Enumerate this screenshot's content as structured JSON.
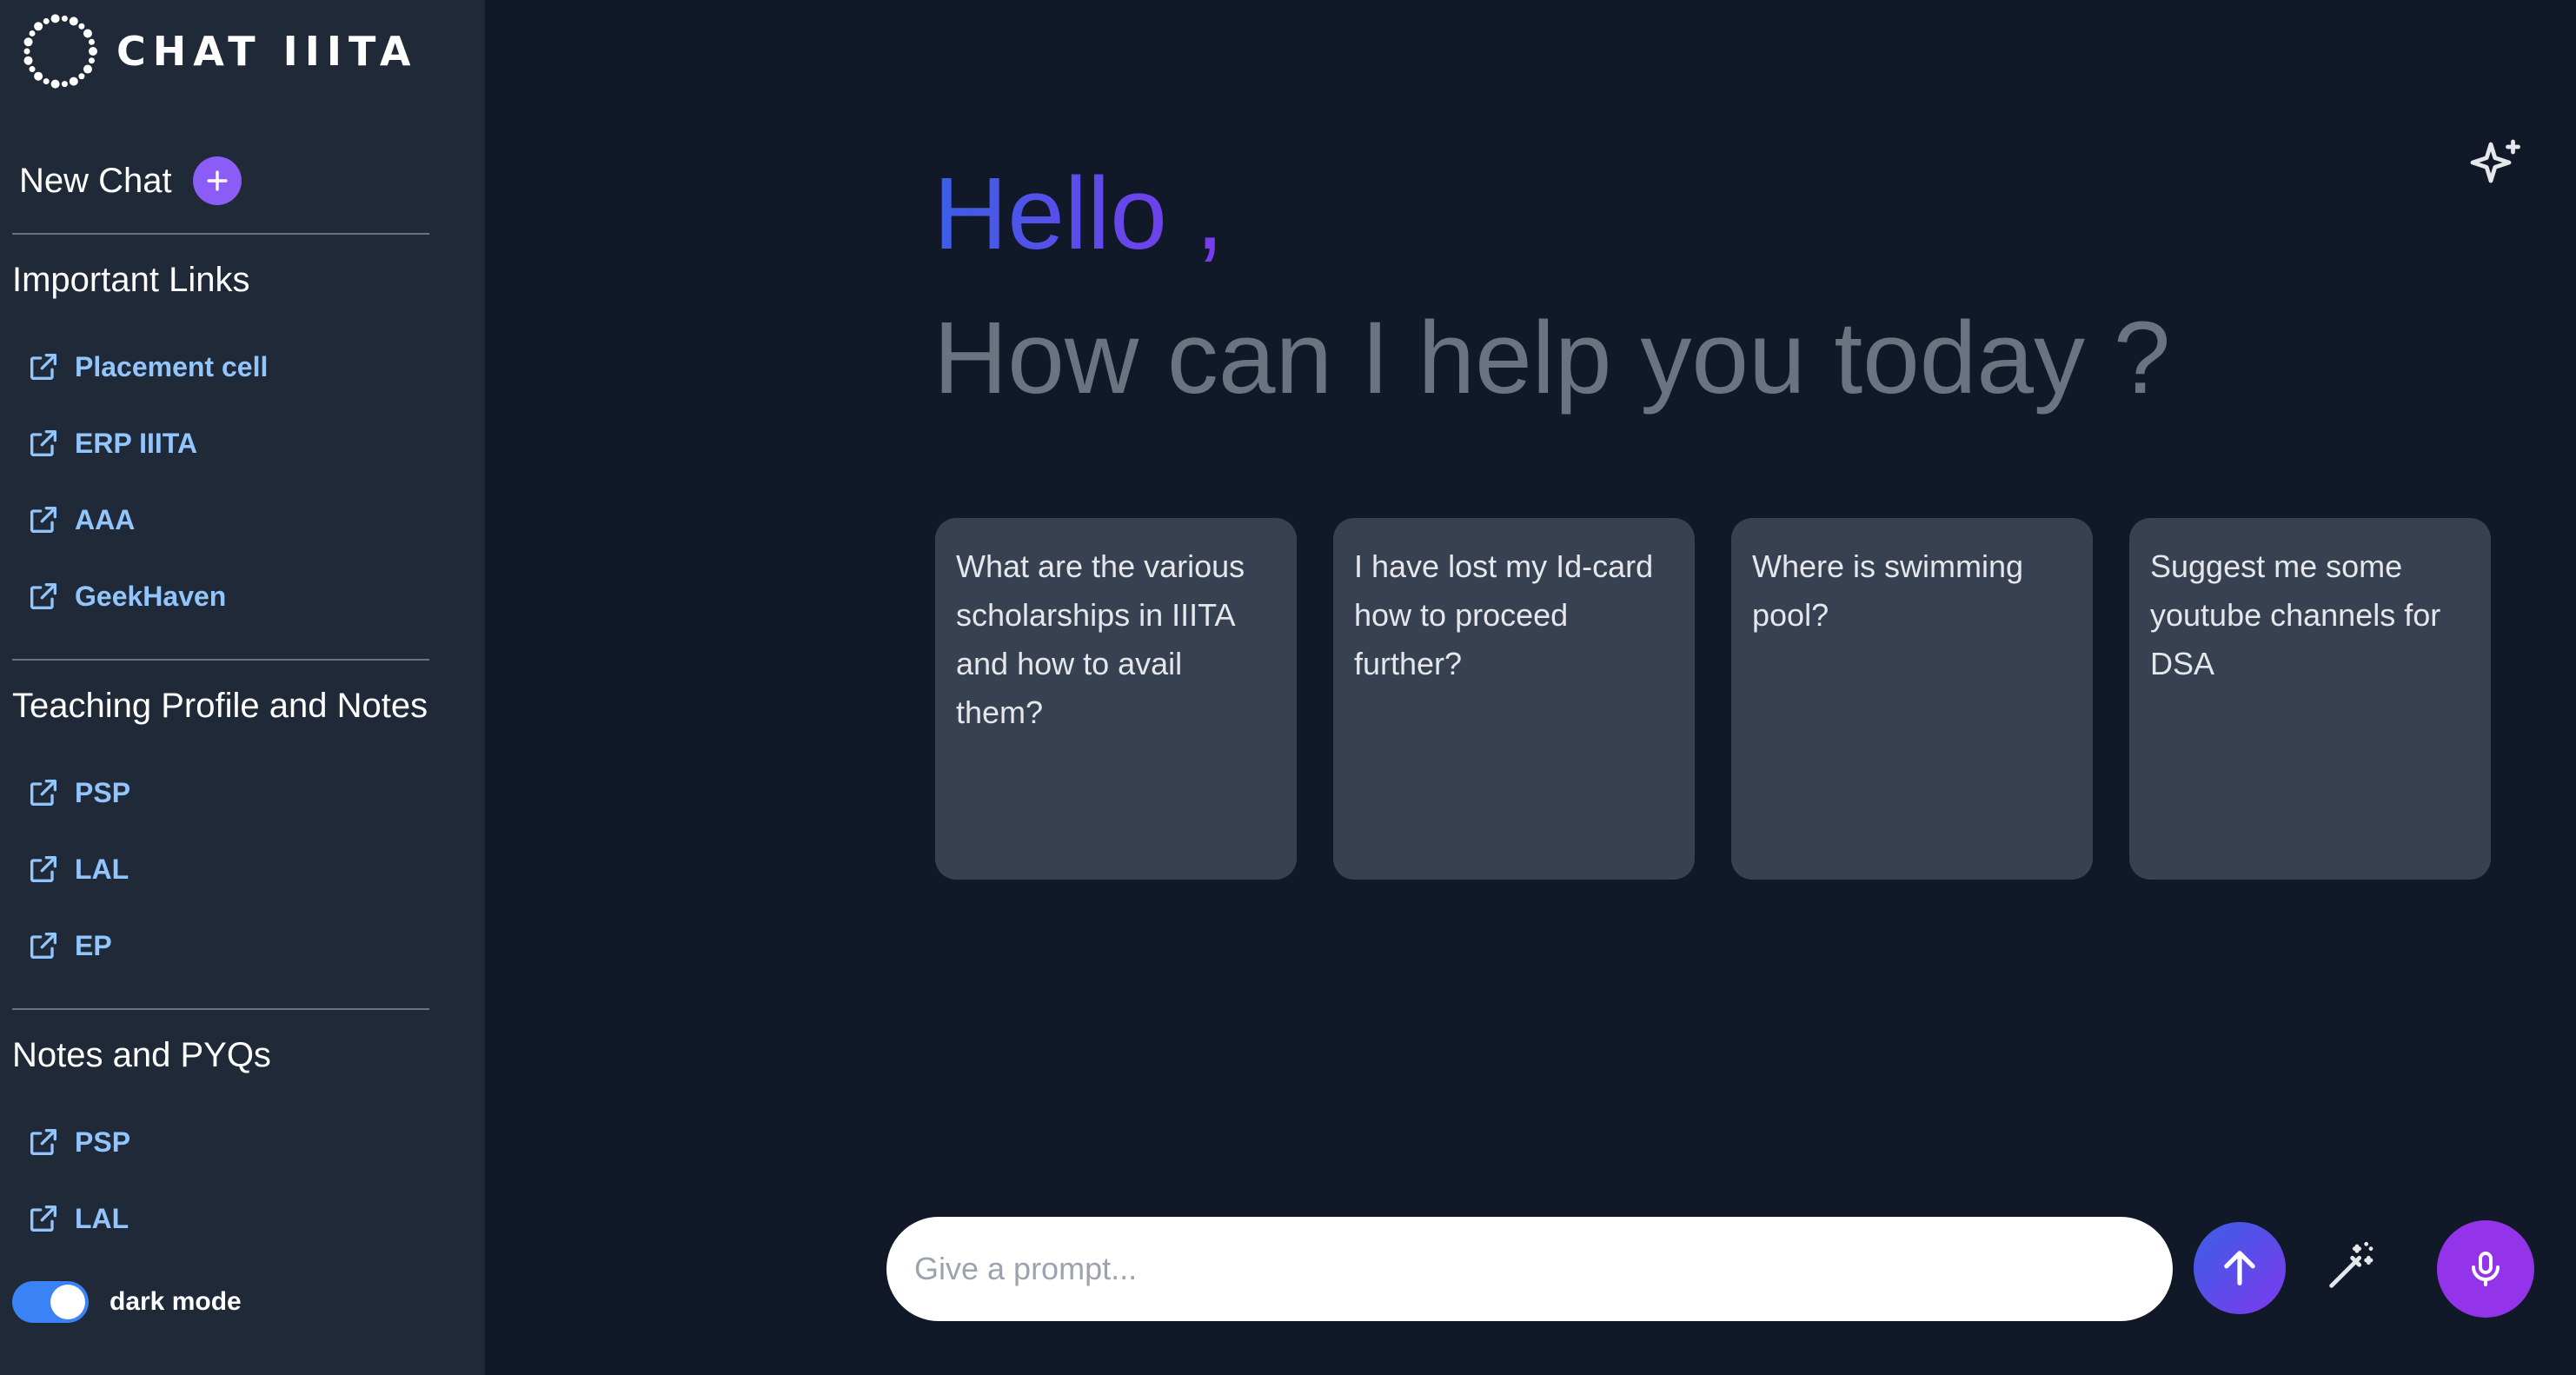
{
  "app": {
    "name": "CHAT IIITA",
    "logo_icon": "dotted-ring-logo"
  },
  "sidebar": {
    "new_chat_label": "New Chat",
    "sections": [
      {
        "title": "Important Links",
        "links": [
          "Placement cell",
          "ERP IIITA",
          "AAA",
          "GeekHaven"
        ]
      },
      {
        "title": "Teaching Profile and Notes",
        "links": [
          "PSP",
          "LAL",
          "EP"
        ]
      },
      {
        "title": "Notes and PYQs",
        "links": [
          "PSP",
          "LAL"
        ]
      }
    ],
    "dark_mode": {
      "label": "dark mode",
      "enabled": true
    }
  },
  "main": {
    "greeting": "Hello ,",
    "subgreeting": "How can I help you today ?",
    "suggestions": [
      "What are the various scholarships in IIITA and how to avail them?",
      "I have lost my Id-card how to proceed further?",
      "Where is swimming pool?",
      "Suggest me some youtube channels for DSA"
    ],
    "prompt": {
      "placeholder": "Give a prompt...",
      "value": ""
    },
    "icons": {
      "top_right": "sparkles-icon",
      "send": "arrow-up-icon",
      "enhance": "magic-wand-icon",
      "voice": "microphone-icon"
    }
  },
  "colors": {
    "background": "#111827",
    "sidebar": "#1f2937",
    "link": "#93c5fd",
    "card": "#374151",
    "accent": "#8b5cf6",
    "mic": "#9333ea"
  }
}
